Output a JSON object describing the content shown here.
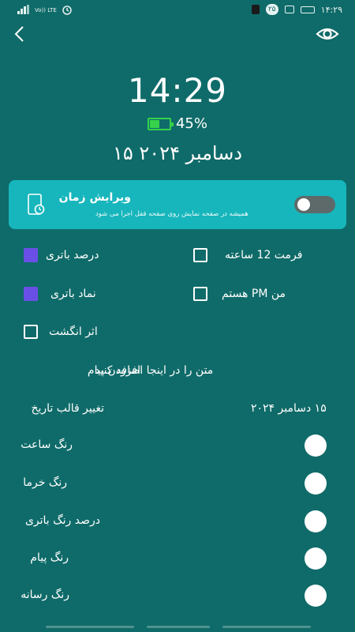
{
  "status_bar": {
    "time": "۱۴:۲۹",
    "network": "Vo)) LTE",
    "notification_count": "۲۵"
  },
  "header": {
    "back_icon": "back-arrow-icon",
    "preview_icon": "eye-icon"
  },
  "clock": {
    "time": "14:29",
    "battery_percent": "45%",
    "battery_level": 0.45,
    "battery_color": "#35d24a",
    "date": "۱۵ دسامبر ۲۰۲۴"
  },
  "edit_card": {
    "title": "ویرایش زمان",
    "subtitle": "همیشه در صفحه نمایش روی صفحه قفل اجرا می شود",
    "enabled": false,
    "background": "#16b6bc"
  },
  "options": {
    "battery_percent": {
      "label": "درصد باتری",
      "checked": true
    },
    "format_12h": {
      "label": "فرمت 12 ساعته",
      "checked": false
    },
    "battery_icon": {
      "label": "نماد باتری",
      "checked": true
    },
    "i_am_pm": {
      "label": "من PM هستم",
      "checked": false
    },
    "fingerprint": {
      "label": "اثر انگشت",
      "checked": false
    }
  },
  "message": {
    "label": "افزودن پیام",
    "placeholder": "متن را در اینجا اضافه کنید"
  },
  "date_format": {
    "label": "تغییر قالب تاریخ",
    "value": "۱۵ دسامبر ۲۰۲۴"
  },
  "color_rows": [
    {
      "label": "رنگ ساعت"
    },
    {
      "label": "رنگ خرما"
    },
    {
      "label": "درصد رنگ باتری"
    },
    {
      "label": "رنگ پیام"
    },
    {
      "label": "رنگ رسانه"
    }
  ],
  "colors": {
    "background": "#0f6b69",
    "checkbox_checked": "#6a4fe6"
  }
}
